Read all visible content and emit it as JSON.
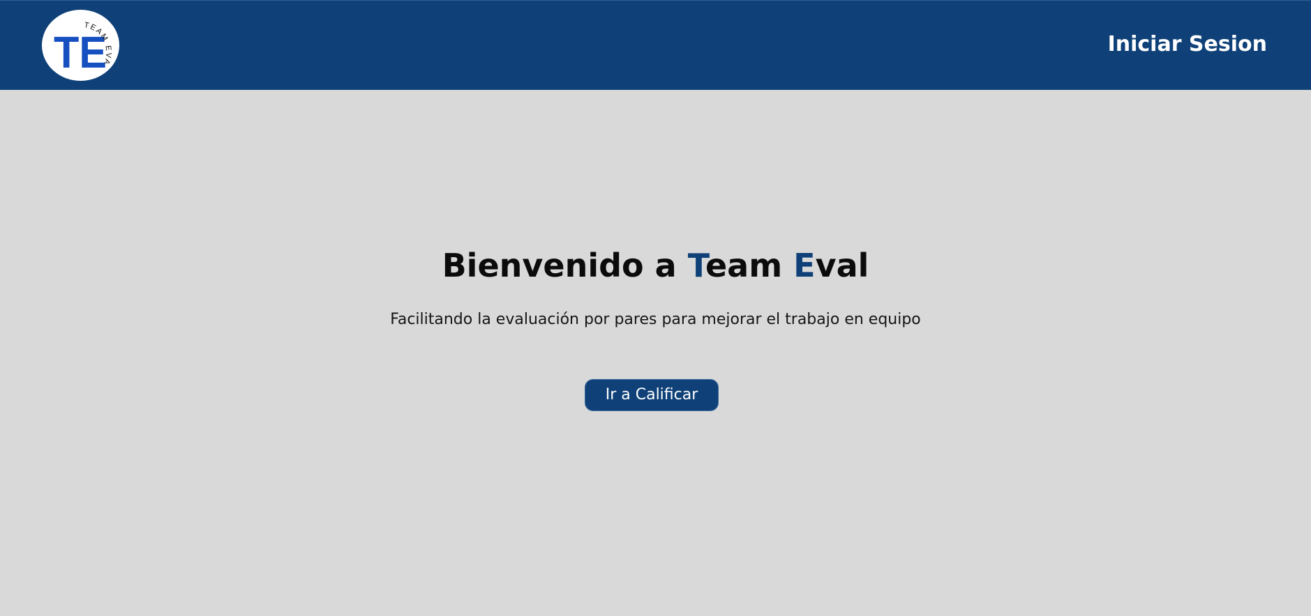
{
  "header": {
    "logo": {
      "icon": "team-eval-logo",
      "letters": "TE",
      "arc_text": "TEAM EVAL"
    },
    "login_label": "Iniciar Sesion"
  },
  "hero": {
    "title": {
      "part1": "Bienvenido a ",
      "accent1": "T",
      "part2": "eam ",
      "accent2": "E",
      "part3": "val"
    },
    "subtitle": "Facilitando la evaluación por pares para mejorar el trabajo en equipo",
    "cta_label": "Ir a Calificar"
  },
  "colors": {
    "header_bg": "#0f4178",
    "page_bg": "#d9d9d9",
    "accent": "#0f4178",
    "logo_letters": "#1650c0",
    "button_text": "#ffffff"
  }
}
